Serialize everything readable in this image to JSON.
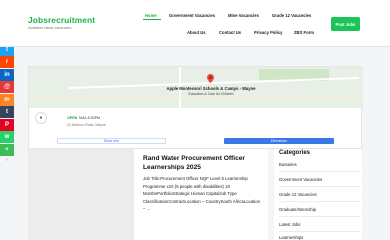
{
  "site": {
    "title": "Jobsrecruitment",
    "tagline": "Available latest vacancies"
  },
  "nav": {
    "row1": [
      "Home",
      "Government Vacancies",
      "Mine Vacancies",
      "Grade 12 Vacancies"
    ],
    "row2": [
      "About Us",
      "Contact Us",
      "Privacy Policy",
      "ZBS Form"
    ],
    "active": "Home"
  },
  "post_jobs_button": "Post Jobs",
  "share_bar": {
    "items": [
      {
        "icon": "facebook-icon",
        "glyph": "f",
        "color": "#1877f2"
      },
      {
        "icon": "twitter-icon",
        "glyph": "t",
        "color": "#1da1f2"
      },
      {
        "icon": "reddit-icon",
        "glyph": "r",
        "color": "#ff4500"
      },
      {
        "icon": "linkedin-icon",
        "glyph": "in",
        "color": "#0a66c2"
      },
      {
        "icon": "email-icon",
        "glyph": "@",
        "color": "#e53935"
      },
      {
        "icon": "mix-icon",
        "glyph": "m",
        "color": "#ff8226"
      },
      {
        "icon": "tumblr-icon",
        "glyph": "t",
        "color": "#35465c"
      },
      {
        "icon": "pinterest-icon",
        "glyph": "P",
        "color": "#e60023"
      },
      {
        "icon": "whatsapp-icon",
        "glyph": "w",
        "color": "#25d366"
      },
      {
        "icon": "share-more-icon",
        "glyph": "+",
        "color": "#3dbb56"
      }
    ],
    "more": "‹"
  },
  "map": {
    "place_name": "Apple Montessori Schools & Camps - Wayne",
    "place_category": "Education & Care for Children",
    "open_label": "OPEN",
    "hours": "7AM–6:30PM",
    "address": "23 Molecco Road, Wayne",
    "store_info_button": "Store info",
    "directions_button": "Directions"
  },
  "post": {
    "title": "Rand Water Procurement Officer Learnerships 2025",
    "excerpt": "Job Title:Procurement Officer NQF Level 5 Learnership Programme x10 (5 people with disabilities) 18 MonthsPortfolioStrategic Human CapitalJob Type ClassificationContractLocation – CountrySouth AfricaLocation – …"
  },
  "categories": {
    "title": "Categories",
    "items": [
      "Bursaries",
      "Government Vacancies",
      "Grade 12 Vacancies",
      "Graduate/Internship",
      "Latest Jobs",
      "Learnerships"
    ]
  }
}
